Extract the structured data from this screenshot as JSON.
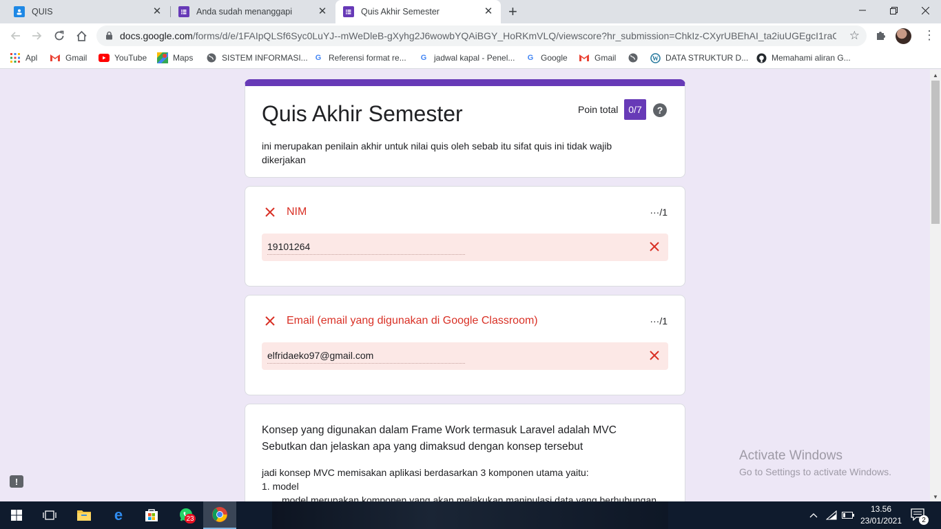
{
  "browser": {
    "tabs": [
      {
        "title": "QUIS",
        "active": false,
        "icon": "classroom-icon"
      },
      {
        "title": "Anda sudah menanggapi",
        "active": false,
        "icon": "forms-icon"
      },
      {
        "title": "Quis Akhir Semester",
        "active": true,
        "icon": "forms-icon"
      }
    ],
    "new_tab": "+",
    "url_main": "docs.google.com",
    "url_rest": "/forms/d/e/1FAIpQLSf6Syc0LuYJ--mWeDleB-gXyhg2J6wowbYQAiBGY_HoRKmVLQ/viewscore?hr_submission=ChkIz-CXyrUBEhAI_ta2iuUGEgcI1raC2oo...",
    "bookmarks": [
      {
        "label": "Apl",
        "icon": "apps-grid-icon"
      },
      {
        "label": "Gmail",
        "icon": "gmail-icon"
      },
      {
        "label": "YouTube",
        "icon": "youtube-icon"
      },
      {
        "label": "Maps",
        "icon": "maps-icon"
      },
      {
        "label": "SISTEM INFORMASI...",
        "icon": "globe-icon"
      },
      {
        "label": "Referensi format re...",
        "icon": "google-icon"
      },
      {
        "label": "jadwal kapal - Penel...",
        "icon": "google-icon"
      },
      {
        "label": "Google",
        "icon": "google-icon"
      },
      {
        "label": "Gmail",
        "icon": "gmail-icon"
      },
      {
        "label": "",
        "icon": "globe-icon"
      },
      {
        "label": "DATA STRUKTUR D...",
        "icon": "wordpress-icon"
      },
      {
        "label": "Memahami aliran G...",
        "icon": "github-icon"
      }
    ]
  },
  "form": {
    "title": "Quis Akhir Semester",
    "points_label": "Poin total",
    "score": "0/7",
    "help": "?",
    "description": "ini merupakan penilain akhir untuk nilai quis oleh sebab itu sifat quis ini tidak wajib dikerjakan",
    "questions": [
      {
        "title": "NIM",
        "points": "···/1",
        "answer": "19101264",
        "status": "incorrect"
      },
      {
        "title": "Email (email yang digunakan di Google Classroom)",
        "points": "···/1",
        "answer": "elfridaeko97@gmail.com",
        "status": "incorrect"
      }
    ],
    "essay": {
      "title_line1": "Konsep yang digunakan dalam Frame Work termasuk Laravel adalah MVC",
      "title_line2": "Sebutkan dan jelaskan apa yang dimaksud dengan konsep tersebut",
      "answer_line1": "jadi konsep MVC memisakan aplikasi berdasarkan  3 komponen utama yaitu:",
      "answer_line2": "1. model",
      "answer_line3": "model merupakan komponen yang akan melakukan manipulasi data yang berhubungan"
    }
  },
  "watermark": {
    "title": "Activate Windows",
    "subtitle": "Go to Settings to activate Windows."
  },
  "taskbar": {
    "apps": [
      {
        "name": "start-button"
      },
      {
        "name": "task-view-button"
      },
      {
        "name": "file-explorer"
      },
      {
        "name": "edge"
      },
      {
        "name": "store"
      },
      {
        "name": "whatsapp",
        "badge": "23"
      },
      {
        "name": "chrome"
      }
    ],
    "time": "13.56",
    "date": "23/01/2021",
    "notification_count": "2"
  },
  "colors": {
    "accent": "#673ab7",
    "error": "#d93025",
    "error_bg": "#fce8e6"
  }
}
